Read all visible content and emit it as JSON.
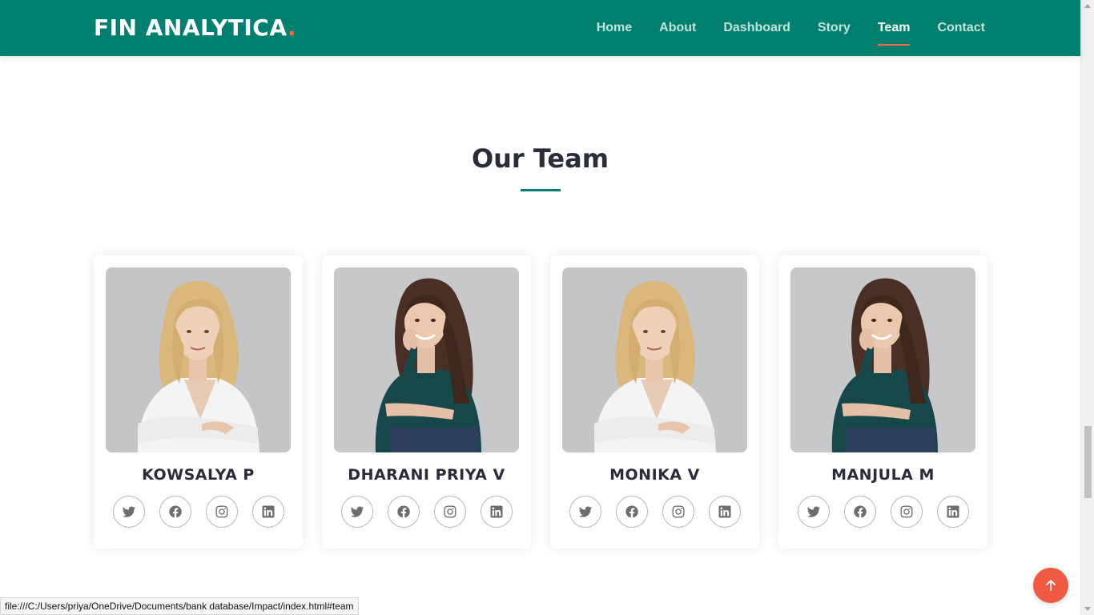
{
  "header": {
    "logo_text": "FIN ANALYTICA",
    "logo_dot": ".",
    "nav": [
      {
        "label": "Home",
        "active": false
      },
      {
        "label": "About",
        "active": false
      },
      {
        "label": "Dashboard",
        "active": false
      },
      {
        "label": "Story",
        "active": false
      },
      {
        "label": "Team",
        "active": true
      },
      {
        "label": "Contact",
        "active": false
      }
    ]
  },
  "team": {
    "title": "Our Team",
    "members": [
      {
        "name": "KOWSALYA P",
        "photo": "blonde-woman-white-blouse"
      },
      {
        "name": "DHARANI PRIYA V",
        "photo": "brunette-woman-teal-top"
      },
      {
        "name": "MONIKA V",
        "photo": "blonde-woman-white-blouse"
      },
      {
        "name": "MANJULA M",
        "photo": "brunette-woman-teal-top"
      }
    ],
    "social_icons": [
      "twitter-icon",
      "facebook-icon",
      "instagram-icon",
      "linkedin-icon"
    ]
  },
  "statusbar": {
    "url": "file:///C:/Users/priya/OneDrive/Documents/bank database/Impact/index.html#team"
  },
  "colors": {
    "header_bg": "#02806f",
    "accent": "#f26a3d",
    "back_to_top": "#f15a42"
  }
}
